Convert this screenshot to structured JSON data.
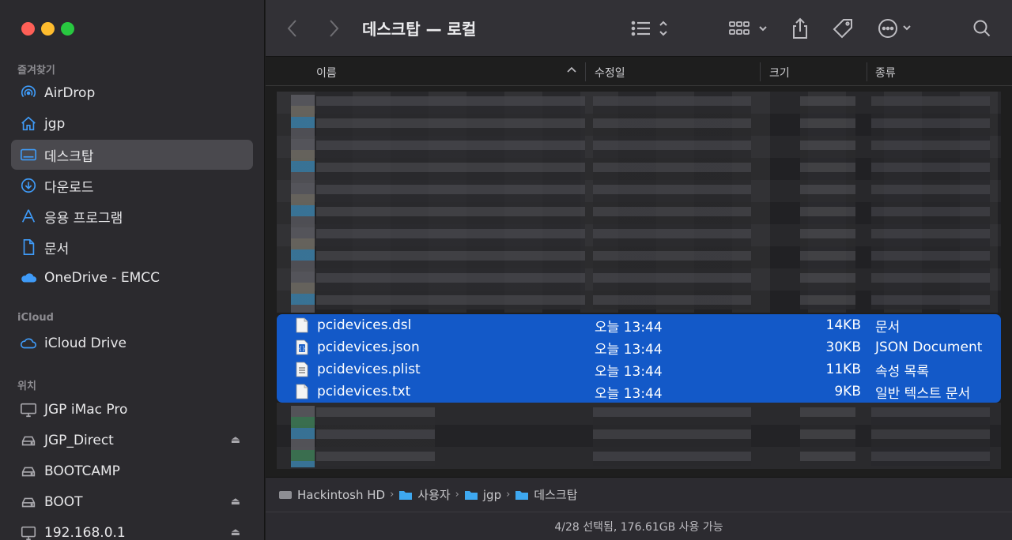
{
  "window": {
    "title": "데스크탑 — 로컬"
  },
  "sidebar": {
    "favorites_label": "즐겨찾기",
    "favorites": [
      {
        "label": "AirDrop",
        "icon": "airdrop-icon"
      },
      {
        "label": "jgp",
        "icon": "home-icon"
      },
      {
        "label": "데스크탑",
        "icon": "desktop-icon",
        "selected": true
      },
      {
        "label": "다운로드",
        "icon": "download-icon"
      },
      {
        "label": "응용 프로그램",
        "icon": "applications-icon"
      },
      {
        "label": "문서",
        "icon": "document-icon"
      },
      {
        "label": "OneDrive - EMCC",
        "icon": "onedrive-icon"
      }
    ],
    "icloud_label": "iCloud",
    "icloud": [
      {
        "label": "iCloud Drive",
        "icon": "icloud-icon"
      }
    ],
    "locations_label": "위치",
    "locations": [
      {
        "label": "JGP iMac Pro",
        "icon": "imac-icon"
      },
      {
        "label": "JGP_Direct",
        "icon": "drive-icon",
        "eject": true
      },
      {
        "label": "BOOTCAMP",
        "icon": "drive-icon"
      },
      {
        "label": "BOOT",
        "icon": "drive-icon",
        "eject": true
      },
      {
        "label": "192.168.0.1",
        "icon": "network-icon",
        "eject": true
      }
    ]
  },
  "columns": {
    "name": "이름",
    "date": "수정일",
    "size": "크기",
    "kind": "종류"
  },
  "files": [
    {
      "name": "pcidevices.dsl",
      "date": "오늘 13:44",
      "size": "14KB",
      "kind": "문서",
      "icon": "text-file-icon"
    },
    {
      "name": "pcidevices.json",
      "date": "오늘 13:44",
      "size": "30KB",
      "kind": "JSON Document",
      "icon": "json-file-icon"
    },
    {
      "name": "pcidevices.plist",
      "date": "오늘 13:44",
      "size": "11KB",
      "kind": "속성 목록",
      "icon": "plist-file-icon"
    },
    {
      "name": "pcidevices.txt",
      "date": "오늘 13:44",
      "size": "9KB",
      "kind": "일반 텍스트 문서",
      "icon": "text-file-icon"
    }
  ],
  "pathbar": [
    "Hackintosh HD",
    "사용자",
    "jgp",
    "데스크탑"
  ],
  "status": "4/28 선택됨, 176.61GB 사용 가능",
  "colors": {
    "selection": "#1359c8",
    "accent": "#3f9bf8",
    "sidebar": "#2b2a2e",
    "content": "#1e1e1e"
  }
}
